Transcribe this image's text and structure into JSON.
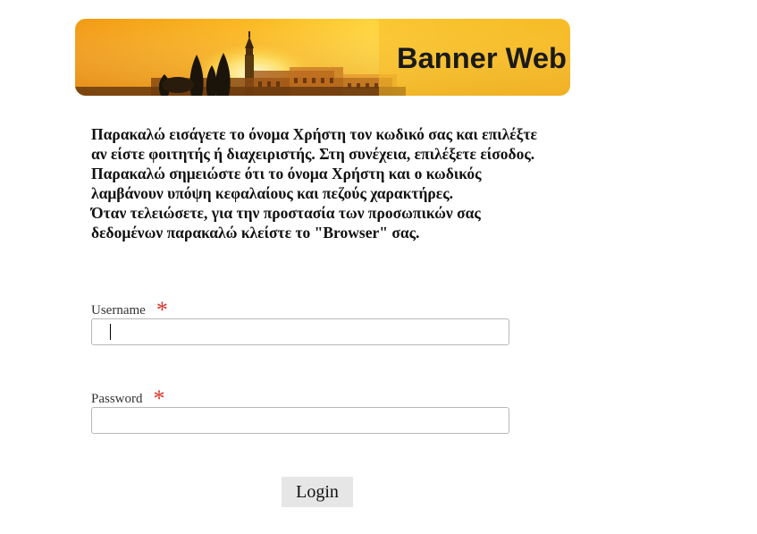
{
  "banner": {
    "title": "Banner Web"
  },
  "instructions": {
    "line1": "Παρακαλώ εισάγετε το όνομα Χρήστη τον κωδικό σας και επιλέξτε αν είστε φοιτητής ή διαχειριστής. Στη συνέχεια, επιλέξετε είσοδος.",
    "line2": "Παρακαλώ σημειώστε ότι το όνομα Χρήστη και ο κωδικός λαμβάνουν υπόψη κεφαλαίους και πεζούς χαρακτήρες.",
    "line3": "Όταν τελειώσετε, για την προστασία των προσωπικών σας δεδομένων παρακαλώ κλείστε το \"Browser\" σας."
  },
  "form": {
    "username_label": "Username",
    "username_value": "",
    "password_label": "Password",
    "password_value": "",
    "required_marker": "*",
    "login_label": "Login"
  }
}
